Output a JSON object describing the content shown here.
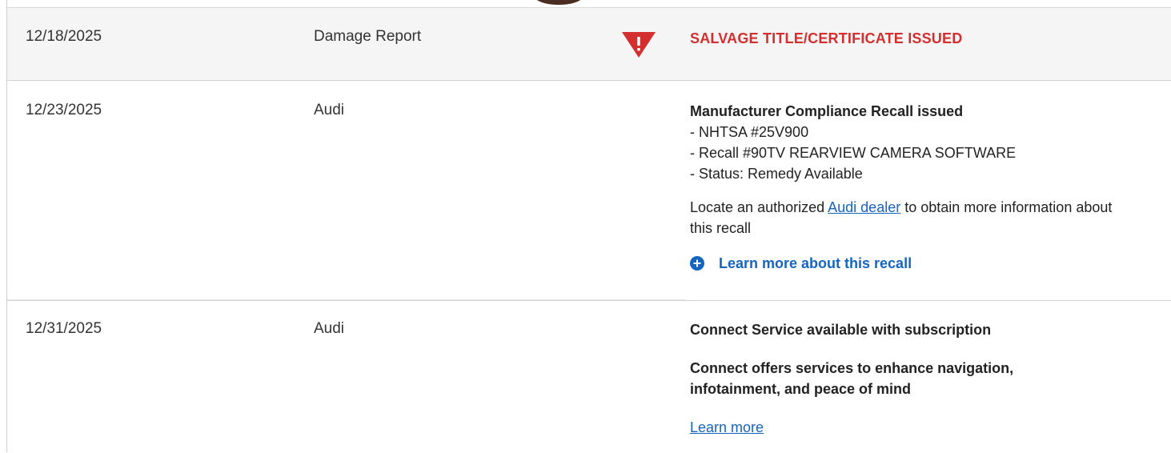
{
  "rows": [
    {
      "date": "12/18/2025",
      "source": "Damage Report",
      "icon": "alert-triangle-icon",
      "detail_title": "SALVAGE TITLE/CERTIFICATE ISSUED"
    },
    {
      "date": "12/23/2025",
      "source": "Audi",
      "detail_title": "Manufacturer Compliance Recall issued",
      "items": [
        "- NHTSA #25V900",
        "- Recall #90TV REARVIEW CAMERA SOFTWARE",
        "- Status: Remedy Available"
      ],
      "locate_prefix": "Locate an authorized ",
      "locate_link": "Audi dealer",
      "locate_suffix": " to obtain more information about this recall",
      "learn_more": "Learn more about this recall",
      "learn_more_icon": "plus-circle-icon"
    },
    {
      "date": "12/31/2025",
      "source": "Audi",
      "detail_title": "Connect Service available with subscription",
      "detail_sub": "Connect offers services to enhance navigation, infotainment, and peace of mind",
      "link": "Learn more"
    }
  ],
  "colors": {
    "alert": "#d32f2f",
    "link": "#1565c0"
  }
}
